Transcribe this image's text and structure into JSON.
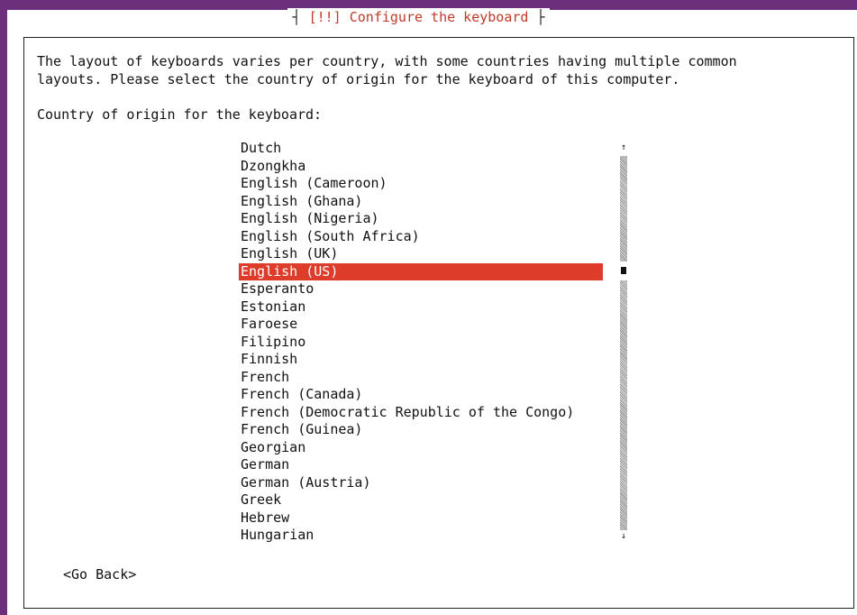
{
  "dialog": {
    "title_left": "┤ ",
    "title": "[!!] Configure the keyboard",
    "title_right": " ├",
    "description_line1": "The layout of keyboards varies per country, with some countries having multiple common",
    "description_line2": "layouts. Please select the country of origin for the keyboard of this computer.",
    "prompt": "Country of origin for the keyboard:"
  },
  "country_list": {
    "selected": "English (US)",
    "items": [
      "Dutch",
      "Dzongkha",
      "English (Cameroon)",
      "English (Ghana)",
      "English (Nigeria)",
      "English (South Africa)",
      "English (UK)",
      "English (US)",
      "Esperanto",
      "Estonian",
      "Faroese",
      "Filipino",
      "Finnish",
      "French",
      "French (Canada)",
      "French (Democratic Republic of the Congo)",
      "French (Guinea)",
      "Georgian",
      "German",
      "German (Austria)",
      "Greek",
      "Hebrew",
      "Hungarian"
    ]
  },
  "scrollbar": {
    "up_arrow": "↑",
    "down_arrow": "↓"
  },
  "buttons": {
    "go_back": "<Go Back>"
  },
  "colors": {
    "frame": "#6b2f7b",
    "selection": "#dd3c2b",
    "title": "#c0392b"
  }
}
